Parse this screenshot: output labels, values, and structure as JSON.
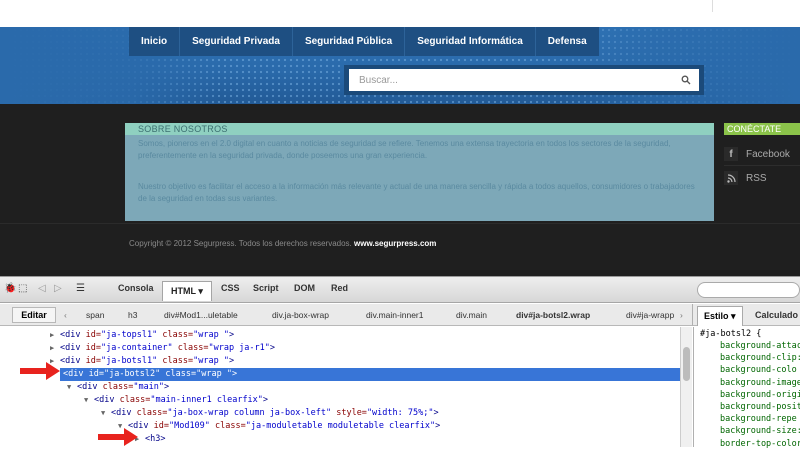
{
  "nav": {
    "items": [
      "Inicio",
      "Seguridad Privada",
      "Seguridad Pública",
      "Seguridad Informática",
      "Defensa"
    ]
  },
  "search": {
    "placeholder": "Buscar..."
  },
  "about": {
    "title": "SOBRE NOSOTROS",
    "p1": "Somos, pioneros en el 2.0 digital en cuanto a noticias de seguridad se refiere. Tenemos una extensa trayectoria en todos los sectores de la seguridad, preferentemente en la seguridad privada, donde poseemos una gran experiencia.",
    "p2": "Nuestro objetivo es facilitar el acceso a la información más relevante y actual de una manera sencilla y rápida a todos aquellos, consumidores o trabajadores de la seguridad en todas sus variantes."
  },
  "connect": {
    "title": "CONÉCTATE",
    "facebook": "Facebook",
    "rss": "RSS"
  },
  "footer": {
    "copyright": "Copyright © 2012 Segurpress. Todos los derechos reservados.",
    "site": "www.segurpress.com"
  },
  "firebug": {
    "tabs": {
      "console": "Consola",
      "html": "HTML",
      "css": "CSS",
      "script": "Script",
      "dom": "DOM",
      "net": "Red"
    },
    "edit": "Editar",
    "breadcrumbs": [
      "span",
      "h3",
      "div#Mod1...uletable",
      "div.ja-box-wrap",
      "div.main-inner1",
      "div.main",
      "div#ja-botsl2.wrap",
      "div#ja-wrapp"
    ],
    "side_tabs": {
      "style": "Estilo",
      "computed": "Calculado"
    },
    "tree": [
      {
        "indent": 0,
        "twisty": "▶",
        "html": "<span class=\"tag\">&lt;div</span> <span class=\"attr\">id=</span><span class=\"val\">\"ja-topsl1\"</span> <span class=\"attr\">class=</span><span class=\"val\">\"wrap \"</span><span class=\"tag\">&gt;</span>"
      },
      {
        "indent": 0,
        "twisty": "▶",
        "html": "<span class=\"tag\">&lt;div</span> <span class=\"attr\">id=</span><span class=\"val\">\"ja-container\"</span> <span class=\"attr\">class=</span><span class=\"val\">\"wrap ja-r1\"</span><span class=\"tag\">&gt;</span>"
      },
      {
        "indent": 0,
        "twisty": "▶",
        "html": "<span class=\"tag\">&lt;div</span> <span class=\"attr\">id=</span><span class=\"val\">\"ja-botsl1\"</span> <span class=\"attr\">class=</span><span class=\"val\">\"wrap \"</span><span class=\"tag\">&gt;</span>"
      },
      {
        "indent": 0,
        "twisty": "",
        "selected": true,
        "html": "<span class=\"tag\">&lt;div</span> <span class=\"attr\">id=</span><span class=\"val\">\"ja-botsl2\"</span> <span class=\"attr\">class=</span><span class=\"val\">\"wrap \"</span><span class=\"tag\">&gt;</span>"
      },
      {
        "indent": 1,
        "twisty": "▼",
        "html": "<span class=\"tag\">&lt;div</span> <span class=\"attr\">class=</span><span class=\"val\">\"main\"</span><span class=\"tag\">&gt;</span>"
      },
      {
        "indent": 2,
        "twisty": "▼",
        "html": "<span class=\"tag\">&lt;div</span> <span class=\"attr\">class=</span><span class=\"val\">\"main-inner1 clearfix\"</span><span class=\"tag\">&gt;</span>"
      },
      {
        "indent": 3,
        "twisty": "▼",
        "html": "<span class=\"tag\">&lt;div</span> <span class=\"attr\">class=</span><span class=\"val\">\"ja-box-wrap column ja-box-left\"</span> <span class=\"attr\">style=</span><span class=\"val\">\"width: 75%;\"</span><span class=\"tag\">&gt;</span>"
      },
      {
        "indent": 4,
        "twisty": "▼",
        "html": "<span class=\"tag\">&lt;div</span> <span class=\"attr\">id=</span><span class=\"val\">\"Mod109\"</span> <span class=\"attr\">class=</span><span class=\"val\">\"ja-moduletable moduletable clearfix\"</span><span class=\"tag\">&gt;</span>"
      },
      {
        "indent": 5,
        "twisty": "▶",
        "html": "<span class=\"tag\">&lt;h3&gt;</span>"
      }
    ],
    "css": {
      "selector": "#ja-botsl2 {",
      "properties": [
        "background-attac",
        "background-clip:",
        "background-colo",
        "background-image",
        "background-origi",
        "background-posit",
        "background-repe",
        "background-size:",
        "border-top-color"
      ]
    }
  },
  "colors": {
    "arrow": "#e8231e",
    "selected_row": "#3875d7",
    "accent_green": "#8bc34a"
  }
}
